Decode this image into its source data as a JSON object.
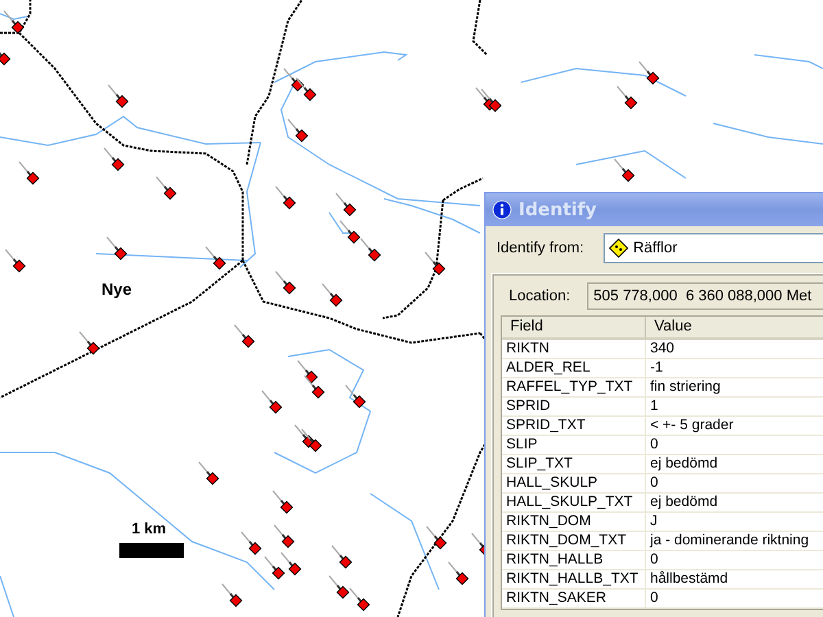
{
  "map": {
    "place_label": "Nye",
    "scale_label": "1 km"
  },
  "window": {
    "title": "Identify"
  },
  "identify_from": {
    "label": "Identify from:",
    "value": "Räfflor"
  },
  "location": {
    "label": "Location:",
    "value": "505 778,000  6 360 088,000 Met"
  },
  "table": {
    "columns": [
      "Field",
      "Value"
    ],
    "rows": [
      {
        "field": "RIKTN",
        "value": "340"
      },
      {
        "field": "ALDER_REL",
        "value": "-1"
      },
      {
        "field": "RAFFEL_TYP_TXT",
        "value": "fin striering"
      },
      {
        "field": "SPRID",
        "value": "1"
      },
      {
        "field": "SPRID_TXT",
        "value": "< +- 5 grader"
      },
      {
        "field": "SLIP",
        "value": "0"
      },
      {
        "field": "SLIP_TXT",
        "value": "ej bedömd"
      },
      {
        "field": "HALL_SKULP",
        "value": "0"
      },
      {
        "field": "HALL_SKULP_TXT",
        "value": "ej bedömd"
      },
      {
        "field": "RIKTN_DOM",
        "value": "J"
      },
      {
        "field": "RIKTN_DOM_TXT",
        "value": "ja - dominerande riktning"
      },
      {
        "field": "RIKTN_HALLB",
        "value": "0"
      },
      {
        "field": "RIKTN_HALLB_TXT",
        "value": "hållbestämd"
      },
      {
        "field": "RIKTN_SAKER",
        "value": "0"
      }
    ]
  }
}
